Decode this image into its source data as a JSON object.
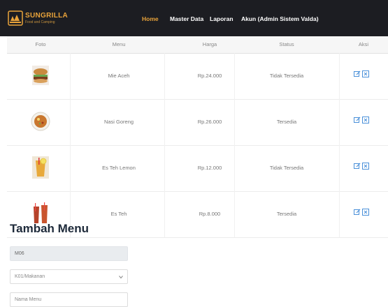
{
  "brand": {
    "name": "SUNGRILLA",
    "tagline": "Food and Camping",
    "color": "#e9a33a"
  },
  "nav": {
    "items": [
      {
        "label": "Home",
        "active": true
      },
      {
        "label": "Master Data",
        "active": false
      },
      {
        "label": "Laporan",
        "active": false
      },
      {
        "label": "Akun (Admin Sistem Valda)",
        "active": false
      }
    ]
  },
  "table": {
    "headers": [
      "Foto",
      "Menu",
      "Harga",
      "Status",
      "Aksi"
    ],
    "rows": [
      {
        "photo_icon": "burger-icon",
        "menu": "Mie Aceh",
        "price": "Rp.24.000",
        "status": "Tidak Tersedia"
      },
      {
        "photo_icon": "fried-rice-icon",
        "menu": "Nasi Goreng",
        "price": "Rp.26.000",
        "status": "Tersedia"
      },
      {
        "photo_icon": "lemon-tea-icon",
        "menu": "Es Teh Lemon",
        "price": "Rp.12.000",
        "status": "Tidak Tersedia"
      },
      {
        "photo_icon": "iced-tea-icon",
        "menu": "Es Teh",
        "price": "Rp.8.000",
        "status": "Tersedia"
      }
    ]
  },
  "form": {
    "title": "Tambah Menu",
    "id_value": "M06",
    "category_value": "K01/Makanan",
    "name_placeholder": "Nama Menu"
  },
  "colors": {
    "navbar": "#1c1d22",
    "action_icon": "#4a90d9"
  }
}
